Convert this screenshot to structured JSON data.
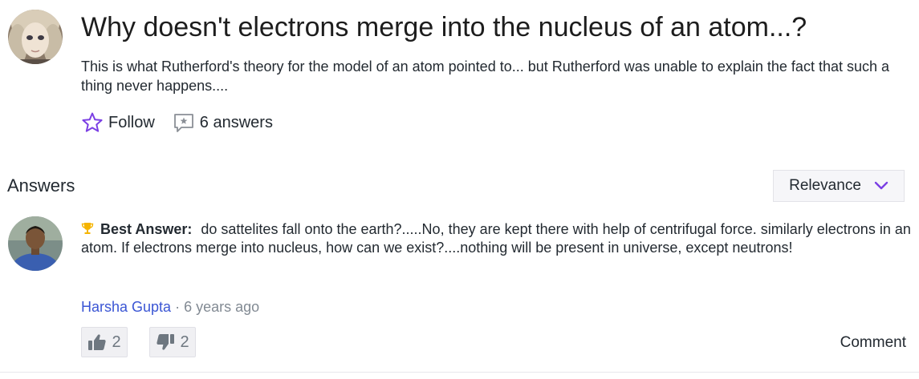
{
  "question": {
    "title": "Why doesn't electrons merge into the nucleus of an atom...?",
    "description": "This is what Rutherford's theory for the model of an atom pointed to... but Rutherford was unable to explain the fact that such a thing never happens....",
    "follow_label": "Follow",
    "answers_count_label": "6 answers"
  },
  "answers_section": {
    "heading": "Answers",
    "sort": {
      "selected": "Relevance"
    }
  },
  "best_answer": {
    "label": "Best Answer:",
    "text": "do sattelites fall onto the earth?.....No, they are kept there with help of centrifugal force. similarly electrons in an atom. If electrons merge into nucleus, how can we exist?....nothing will be present in universe, except neutrons!",
    "author": "Harsha Gupta",
    "separator": "·",
    "time": "6 years ago",
    "upvotes": "2",
    "downvotes": "2",
    "comment_label": "Comment"
  },
  "icons": {
    "follow": "star-outline-icon",
    "answers": "speech-bubble-star-icon",
    "sort": "chevron-down-icon",
    "best": "trophy-icon",
    "upvote": "thumbs-up-icon",
    "downvote": "thumbs-down-icon"
  },
  "colors": {
    "accent": "#7b3fe4",
    "author_link": "#3a55d4",
    "trophy": "#f5b400",
    "muted": "#828a93",
    "vote_bg": "#f0f0f3"
  }
}
